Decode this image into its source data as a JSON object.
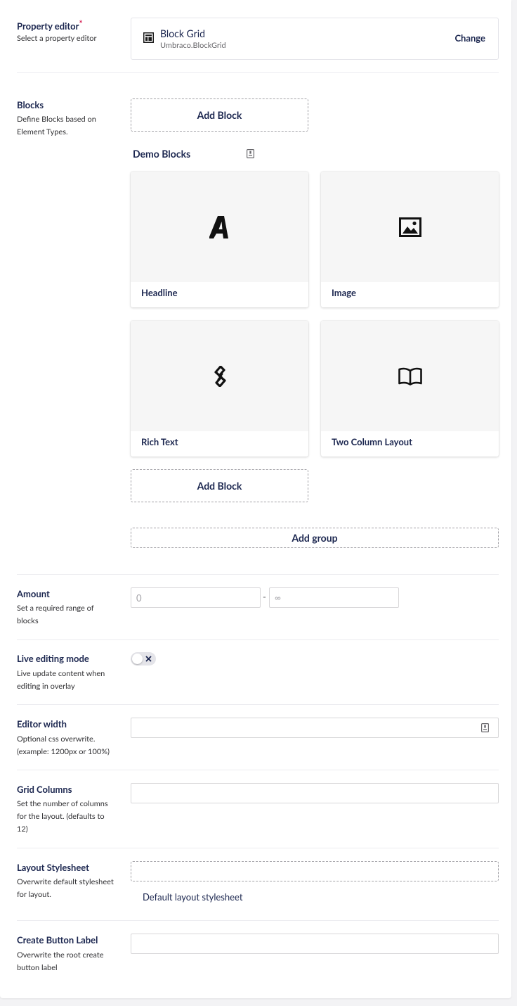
{
  "property_editor": {
    "label": "Property editor",
    "required_mark": "*",
    "description": "Select a property editor",
    "name": "Block Grid",
    "alias": "Umbraco.BlockGrid",
    "change_label": "Change",
    "icon": "layout-icon"
  },
  "blocks": {
    "label": "Blocks",
    "description": "Define Blocks based on Element Types.",
    "add_block_label": "Add Block",
    "group_name": "Demo Blocks",
    "group_icon": "document-icon",
    "cards": [
      {
        "name": "Headline",
        "icon": "font-icon"
      },
      {
        "name": "Image",
        "icon": "picture-icon"
      },
      {
        "name": "Rich Text",
        "icon": "rich-text-icon"
      },
      {
        "name": "Two Column Layout",
        "icon": "book-icon"
      }
    ],
    "add_group_label": "Add group"
  },
  "amount": {
    "label": "Amount",
    "description": "Set a required range of blocks",
    "min_placeholder": "0",
    "separator": "-",
    "max_placeholder": "∞"
  },
  "live_editing": {
    "label": "Live editing mode",
    "description": "Live update content when editing in overlay",
    "toggle_state": "off",
    "toggle_icon": "close-icon"
  },
  "editor_width": {
    "label": "Editor width",
    "description": "Optional css overwrite. (example: 1200px or 100%)",
    "value": "",
    "icon": "document-icon"
  },
  "grid_columns": {
    "label": "Grid Columns",
    "description": "Set the number of columns for the layout. (defaults to 12)",
    "value": ""
  },
  "layout_stylesheet": {
    "label": "Layout Stylesheet",
    "description": "Overwrite default stylesheet for layout.",
    "default_text": "Default layout stylesheet"
  },
  "create_button_label": {
    "label": "Create Button Label",
    "description": "Overwrite the root create button label",
    "value": ""
  },
  "colors": {
    "text": "#1b264f",
    "required": "#d42054",
    "divider": "#ececf0",
    "dashed_border": "#a2a1a6",
    "card_thumb_bg": "#f6f6f6"
  }
}
